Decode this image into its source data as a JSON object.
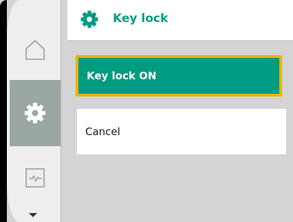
{
  "header": {
    "title": "Key lock",
    "icon": "gear-icon"
  },
  "sidebar": {
    "items": [
      {
        "icon": "home-icon",
        "selected": false
      },
      {
        "icon": "gear-icon",
        "selected": true
      },
      {
        "icon": "diagnostics-icon",
        "selected": false
      }
    ],
    "scroll_icon": "caret-down-icon"
  },
  "menu": {
    "options": [
      {
        "label": "Key lock ON",
        "selected": true
      },
      {
        "label": "Cancel",
        "selected": false
      }
    ]
  },
  "colors": {
    "accent": "#009c82",
    "focus_border": "#e8b400",
    "nav_selected": "#9ba7a3",
    "background": "#d4d4d4"
  }
}
